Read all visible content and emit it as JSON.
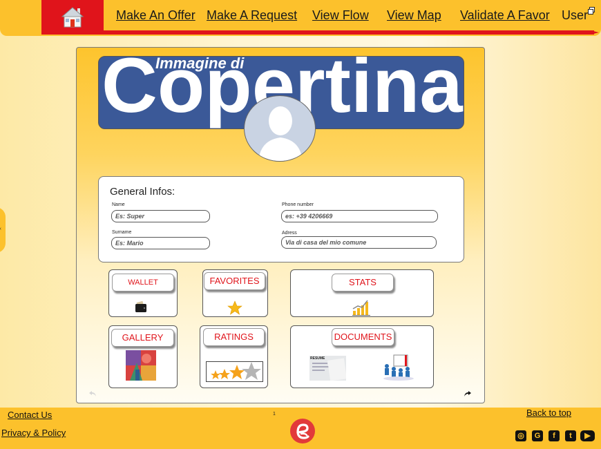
{
  "nav": {
    "links": [
      "Make An Offer",
      "Make A Request",
      "View Flow",
      "View Map",
      "Validate A Favor"
    ],
    "user_label": "User"
  },
  "cover": {
    "subtitle": "Immagine di",
    "title": "Copertina"
  },
  "info": {
    "title": "General Infos:",
    "name_label": "Name",
    "name_placeholder": "Es: Super",
    "surname_label": "Surname",
    "surname_placeholder": "Es: Mario",
    "phone_label": "Phone number",
    "phone_placeholder": "es: +39 4206669",
    "address_label": "Adress",
    "address_placeholder": "Via di casa del mio comune"
  },
  "tiles": {
    "wallet": "WALLET",
    "favorites": "FAVORITES",
    "stats": "STATS",
    "gallery": "GALLERY",
    "ratings": "RATINGS",
    "documents": "DOCUMENTS",
    "resume": "RESUME"
  },
  "footer": {
    "contact": "Contact Us",
    "privacy": "Privacy & Policy",
    "page_number": "1",
    "back_to_top": "Back to top"
  },
  "colors": {
    "yellow": "#fcc12c",
    "red": "#e0141b",
    "cover_blue": "#3b5998"
  }
}
